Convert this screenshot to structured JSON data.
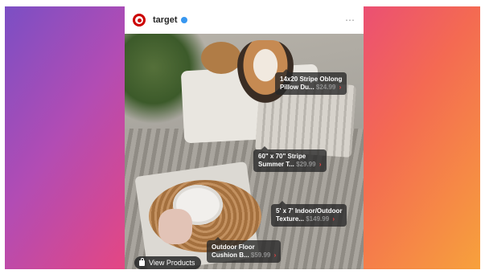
{
  "post": {
    "account": "target",
    "more_icon": "⋯"
  },
  "tags": [
    {
      "line1": "14x20 Stripe Oblong",
      "line2": "Pillow Du...",
      "price": "$24.99"
    },
    {
      "line1": "60\" x 70\" Stripe",
      "line2": "Summer T...",
      "price": "$29.99"
    },
    {
      "line1": "5' x 7' Indoor/Outdoor",
      "line2": "Texture...",
      "price": "$149.99"
    },
    {
      "line1": "Outdoor Floor",
      "line2": "Cushion B...",
      "price": "$59.99"
    }
  ],
  "view_products": {
    "label": "View Products"
  },
  "colors": {
    "brand_red": "#cc0000",
    "verified_blue": "#3897f0",
    "tag_bg": "#262626"
  }
}
